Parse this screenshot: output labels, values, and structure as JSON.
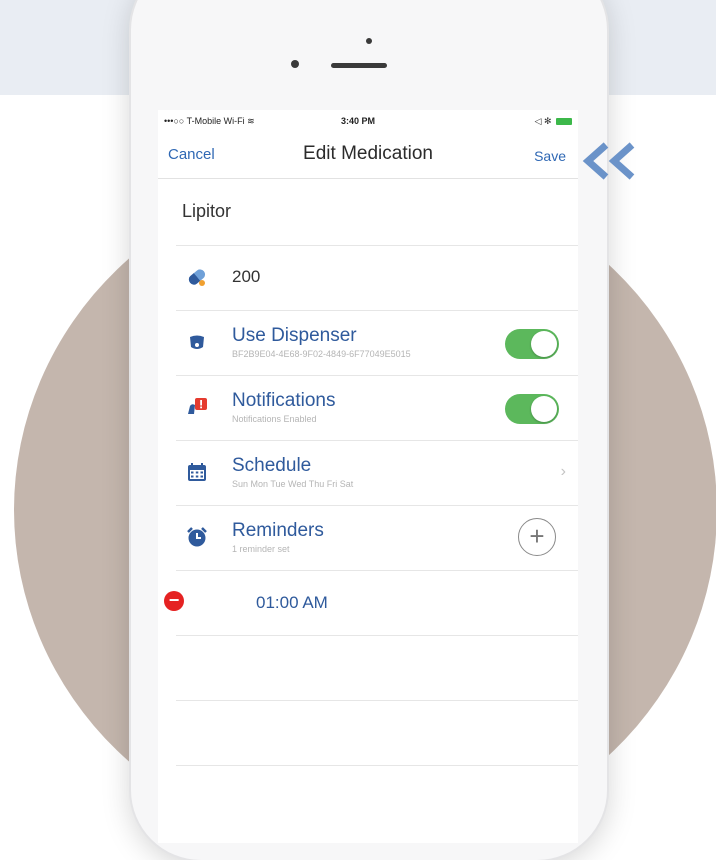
{
  "status_bar": {
    "carrier": "•••○○ T-Mobile Wi-Fi ≋",
    "time": "3:40 PM",
    "right_icons": "◁ ✻"
  },
  "nav": {
    "cancel_label": "Cancel",
    "title": "Edit Medication",
    "save_label": "Save"
  },
  "medication": {
    "name": "Lipitor"
  },
  "dosage": {
    "value": "200",
    "icon": "pill-icon"
  },
  "rows": {
    "dispenser": {
      "title": "Use Dispenser",
      "subtitle": "BF2B9E04-4E68-9F02-4849-6F77049E5015",
      "enabled": true,
      "icon": "dispenser-icon"
    },
    "notifications": {
      "title": "Notifications",
      "subtitle": "Notifications Enabled",
      "enabled": true,
      "icon": "notification-bell-icon"
    },
    "schedule": {
      "title": "Schedule",
      "subtitle": "Sun Mon Tue Wed Thu Fri Sat",
      "icon": "calendar-icon"
    },
    "reminders": {
      "title": "Reminders",
      "subtitle": "1 reminder set",
      "icon": "alarm-clock-icon",
      "add_symbol": "+"
    }
  },
  "reminder_times": [
    {
      "time": "01:00 AM",
      "remove_symbol": "−"
    }
  ],
  "colors": {
    "accent": "#2f68b4",
    "toggle_on": "#5cb85c",
    "delete": "#e52222",
    "background_circle": "#c4b6ad",
    "arrow": "#6b93c9"
  }
}
